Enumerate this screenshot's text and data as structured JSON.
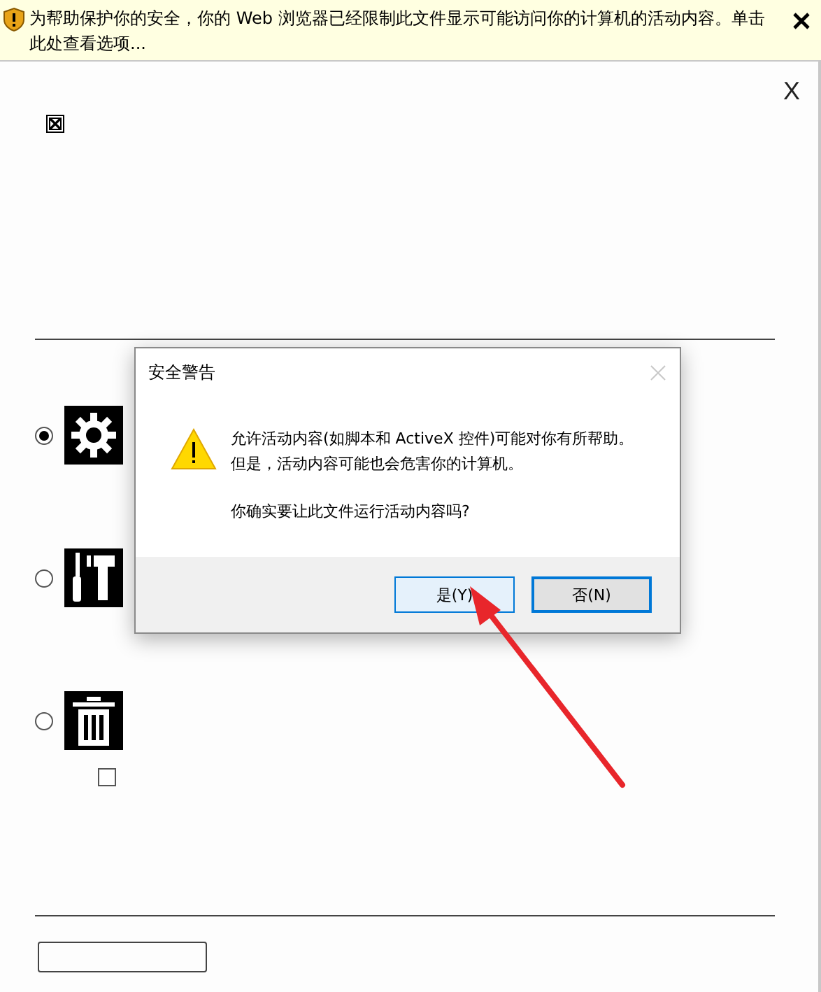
{
  "info_bar": {
    "text": "为帮助保护你的安全，你的 Web 浏览器已经限制此文件显示可能访问你的计算机的活动内容。单击此处查看选项..."
  },
  "page": {
    "close_label": "X",
    "options": [
      {
        "kind": "gear",
        "selected": true
      },
      {
        "kind": "tools",
        "selected": false
      },
      {
        "kind": "trash",
        "selected": false,
        "checkbox": {
          "checked": false
        }
      }
    ]
  },
  "dialog": {
    "title": "安全警告",
    "message_lines": [
      "允许活动内容(如脚本和 ActiveX 控件)可能对你有所帮助。",
      "但是，活动内容可能也会危害你的计算机。"
    ],
    "question": "你确实要让此文件运行活动内容吗?",
    "buttons": [
      {
        "label": "是(Y)",
        "selected": true
      },
      {
        "label": "否(N)",
        "selected": false
      }
    ]
  }
}
